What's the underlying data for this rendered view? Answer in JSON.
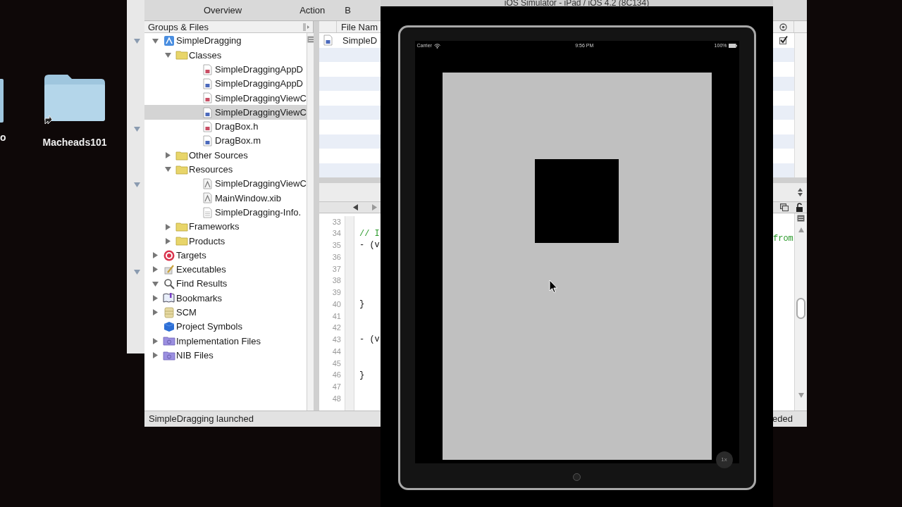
{
  "desktop": {
    "icons": [
      {
        "label": "o",
        "kind": "partial"
      },
      {
        "label": "Macheads101",
        "kind": "folder"
      }
    ]
  },
  "xcode": {
    "toolbar": [
      "Overview",
      "Action",
      "B"
    ],
    "groups": {
      "header": "Groups & Files",
      "tree": [
        {
          "label": "SimpleDragging",
          "kind": "project",
          "expanded": true,
          "selected": false,
          "children": [
            {
              "label": "Classes",
              "kind": "folder",
              "expanded": true,
              "selected": false,
              "children": [
                {
                  "label": "SimpleDraggingAppD",
                  "kind": "h",
                  "selected": false
                },
                {
                  "label": "SimpleDraggingAppD",
                  "kind": "m",
                  "selected": false
                },
                {
                  "label": "SimpleDraggingViewC",
                  "kind": "h",
                  "selected": false
                },
                {
                  "label": "SimpleDraggingViewC",
                  "kind": "m",
                  "selected": true
                },
                {
                  "label": "DragBox.h",
                  "kind": "h",
                  "selected": false
                },
                {
                  "label": "DragBox.m",
                  "kind": "m",
                  "selected": false
                }
              ]
            },
            {
              "label": "Other Sources",
              "kind": "folder",
              "expanded": false,
              "selected": false
            },
            {
              "label": "Resources",
              "kind": "folder",
              "expanded": true,
              "selected": false,
              "children": [
                {
                  "label": "SimpleDraggingViewC",
                  "kind": "xib",
                  "selected": false
                },
                {
                  "label": "MainWindow.xib",
                  "kind": "xib",
                  "selected": false
                },
                {
                  "label": "SimpleDragging-Info.",
                  "kind": "plist",
                  "selected": false
                }
              ]
            },
            {
              "label": "Frameworks",
              "kind": "folder",
              "expanded": false,
              "selected": false
            },
            {
              "label": "Products",
              "kind": "folder",
              "expanded": false,
              "selected": false
            }
          ]
        },
        {
          "label": "Targets",
          "kind": "target",
          "expanded": false,
          "selected": false
        },
        {
          "label": "Executables",
          "kind": "executables",
          "expanded": false,
          "selected": false
        },
        {
          "label": "Find Results",
          "kind": "search",
          "expanded": true,
          "selected": false
        },
        {
          "label": "Bookmarks",
          "kind": "bookmarks",
          "expanded": false,
          "selected": false
        },
        {
          "label": "SCM",
          "kind": "scm",
          "expanded": false,
          "selected": false
        },
        {
          "label": "Project Symbols",
          "kind": "symbols",
          "selected": false
        },
        {
          "label": "Implementation Files",
          "kind": "smart",
          "expanded": false,
          "selected": false
        },
        {
          "label": "NIB Files",
          "kind": "smart",
          "expanded": false,
          "selected": false
        }
      ]
    },
    "file_list": {
      "column": "File Nam",
      "rows": [
        {
          "name": "SimpleD",
          "kind": "m"
        }
      ]
    },
    "editor": {
      "lines": [
        {
          "number": "33"
        },
        {
          "number": "34",
          "code": "// I",
          "kind": "comment"
        },
        {
          "number": "35",
          "code": "- (v",
          "kind": "code"
        },
        {
          "number": "36"
        },
        {
          "number": "37"
        },
        {
          "number": "38"
        },
        {
          "number": "39"
        },
        {
          "number": "40",
          "code": "}",
          "kind": "code"
        },
        {
          "number": "41"
        },
        {
          "number": "42"
        },
        {
          "number": "43",
          "code": "- (v",
          "kind": "code"
        },
        {
          "number": "44"
        },
        {
          "number": "45"
        },
        {
          "number": "46",
          "code": "}",
          "kind": "code"
        },
        {
          "number": "47"
        },
        {
          "number": "48"
        }
      ],
      "right_text": "from"
    },
    "status": "SimpleDragging launched",
    "status_right": "eded"
  },
  "simulator": {
    "title": "iOS Simulator - iPad / iOS 4.2 (8C134)",
    "carrier": "Carrier",
    "time": "9:56 PM",
    "battery": "100%",
    "zoom": "1x"
  }
}
